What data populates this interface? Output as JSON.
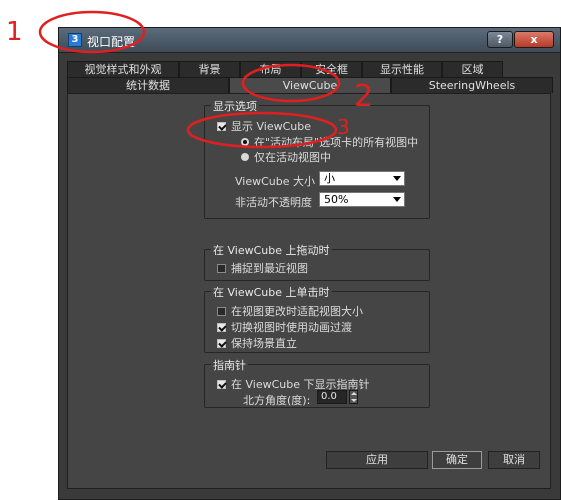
{
  "window": {
    "title": "视口配置",
    "help_label": "?",
    "close_label": "x"
  },
  "tabs": {
    "row1": [
      "视觉样式和外观",
      "背景",
      "布局",
      "安全框",
      "显示性能",
      "区域"
    ],
    "row2": [
      "统计数据",
      "ViewCube",
      "SteeringWheels"
    ],
    "active": "ViewCube"
  },
  "display_options": {
    "group_title": "显示选项",
    "show_viewcube_label": "显示 ViewCube",
    "show_viewcube_checked": true,
    "radio_all_label": "在\"活动布局\"选项卡的所有视图中",
    "radio_active_label": "仅在活动视图中",
    "size_label": "ViewCube 大小",
    "size_value": "小",
    "opacity_label": "非活动不透明度",
    "opacity_value": "50%"
  },
  "drag_group": {
    "group_title": "在 ViewCube 上拖动时",
    "snap_label": "捕捉到最近视图",
    "snap_checked": false
  },
  "click_group": {
    "group_title": "在 ViewCube 上单击时",
    "fit_label": "在视图更改时适配视图大小",
    "fit_checked": false,
    "animate_label": "切换视图时使用动画过渡",
    "animate_checked": true,
    "upright_label": "保持场景直立",
    "upright_checked": true
  },
  "compass_group": {
    "group_title": "指南针",
    "show_compass_label": "在 ViewCube 下显示指南针",
    "show_compass_checked": true,
    "north_angle_label": "北方角度(度):",
    "north_angle_value": "0.0"
  },
  "footer": {
    "apply_label": "应用",
    "ok_label": "确定",
    "cancel_label": "取消"
  },
  "annotations": {
    "num1": "1",
    "num2": "2",
    "num3": "3",
    "color": "#e02020"
  }
}
